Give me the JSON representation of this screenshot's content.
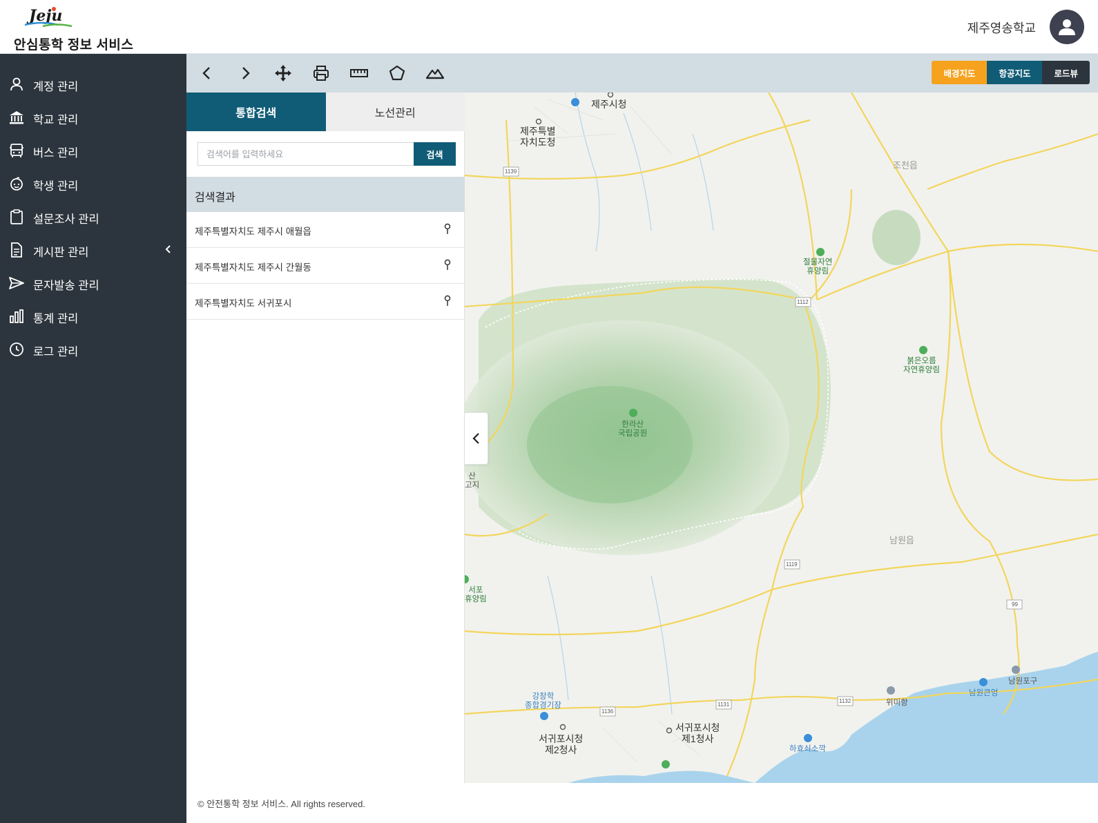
{
  "header": {
    "logo_title": "안심통학 정보 서비스",
    "school_name": "제주영송학교"
  },
  "sidebar": {
    "items": [
      {
        "label": "계정 관리",
        "icon": "user-icon"
      },
      {
        "label": "학교 관리",
        "icon": "school-icon"
      },
      {
        "label": "버스 관리",
        "icon": "bus-icon"
      },
      {
        "label": "학생 관리",
        "icon": "student-icon"
      },
      {
        "label": "설문조사 관리",
        "icon": "clipboard-icon"
      },
      {
        "label": "게시판 관리",
        "icon": "document-icon"
      },
      {
        "label": "문자발송 관리",
        "icon": "send-icon"
      },
      {
        "label": "통계 관리",
        "icon": "chart-icon"
      },
      {
        "label": "로그 관리",
        "icon": "clock-icon"
      }
    ]
  },
  "toolbar": {
    "tools": [
      "back-icon",
      "forward-icon",
      "move-icon",
      "print-icon",
      "ruler-icon",
      "polygon-icon",
      "terrain-icon"
    ],
    "map_types": [
      {
        "label": "배경지도",
        "color": "#f6a21e"
      },
      {
        "label": "항공지도",
        "color": "#105c76"
      },
      {
        "label": "로드뷰",
        "color": "#2c353d"
      }
    ]
  },
  "panel": {
    "tabs": [
      "통합검색",
      "노선관리"
    ],
    "search": {
      "placeholder": "검색어를 입력하세요",
      "button": "검색"
    },
    "results_title": "검색결과",
    "results": [
      "제주특별자치도 제주시 애월읍",
      "제주특별자치도 제주시 간월동",
      "제주특별자치도 서귀포시"
    ]
  },
  "map": {
    "labels": {
      "jeju_city_hall": "제주시청",
      "jeju_province_office": "제주특별\n자치도청",
      "jocheon": "조천읍",
      "jeolmul": "절물자연\n휴양림",
      "bukeun": "붉은오름\n자연휴양림",
      "hallasan": "한라산\n국립공원",
      "namwon": "남원읍",
      "gangchang": "강창학\n종합경기장",
      "seogwipo_2": "서귀포시청\n제2청사",
      "seogwipo_1": "서귀포시청\n제1청사",
      "wimihang": "위미항",
      "namwonpogu": "남원포구",
      "namwonkeuneong": "남원큰엉",
      "hahyo": "하효쇠소깍",
      "edge_san": "산\n고지",
      "edge_seogwipo": "서포\n휴양림",
      "road_1139": "1139",
      "road_1112": "1112",
      "road_1119": "1119",
      "road_99": "99",
      "road_1136": "1136",
      "road_1131": "1131",
      "road_1132": "1132"
    }
  },
  "footer": {
    "copyright": "© 안전통학 정보 서비스. All rights reserved."
  }
}
